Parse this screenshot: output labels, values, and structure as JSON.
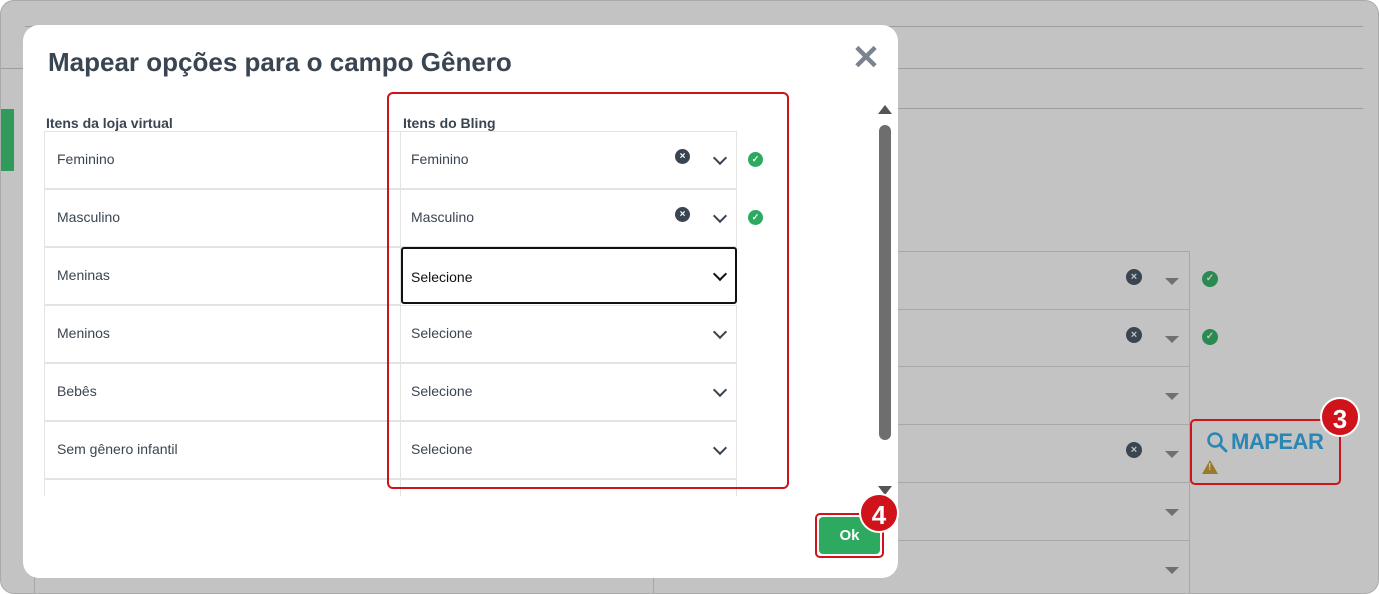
{
  "modal": {
    "title": "Mapear opções para o campo Gênero",
    "close_glyph": "✕",
    "col_left": "Itens da loja virtual",
    "col_right": "Itens do Bling",
    "rows": [
      {
        "store_item": "Feminino",
        "bling_value": "Feminino",
        "has_clear": true,
        "mapped": true
      },
      {
        "store_item": "Masculino",
        "bling_value": "Masculino",
        "has_clear": true,
        "mapped": true
      },
      {
        "store_item": "Meninas",
        "bling_value": "Selecione",
        "has_clear": false,
        "mapped": false,
        "focused": true
      },
      {
        "store_item": "Meninos",
        "bling_value": "Selecione",
        "has_clear": false,
        "mapped": false
      },
      {
        "store_item": "Bebês",
        "bling_value": "Selecione",
        "has_clear": false,
        "mapped": false
      },
      {
        "store_item": "Sem gênero infantil",
        "bling_value": "Selecione",
        "has_clear": false,
        "mapped": false
      }
    ],
    "ok_label": "Ok"
  },
  "background": {
    "mapear_label": "MAPEAR"
  },
  "annotations": {
    "badge_3": "3",
    "badge_4": "4"
  },
  "colors": {
    "accent_green": "#2daa5f",
    "highlight_red": "#d0121b",
    "text_dark": "#3a4552",
    "link_blue": "#2a86b3"
  }
}
